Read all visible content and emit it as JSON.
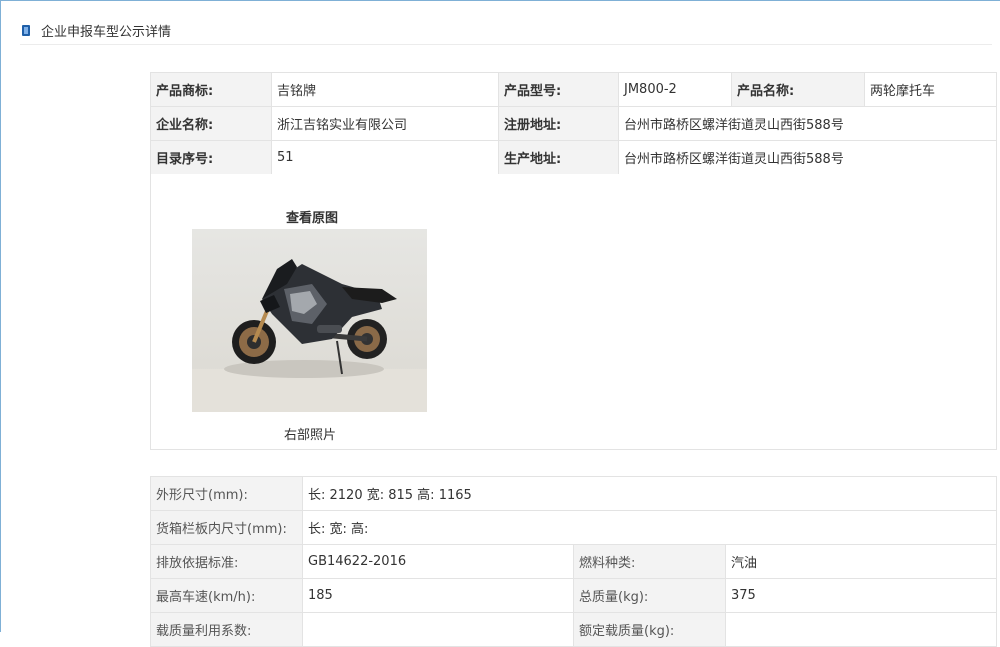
{
  "header": {
    "title": "企业申报车型公示详情",
    "icon": "book-icon"
  },
  "info": {
    "trademark_label": "产品商标:",
    "trademark": "吉铭牌",
    "model_label": "产品型号:",
    "model": "JM800-2",
    "product_name_label": "产品名称:",
    "product_name": "两轮摩托车",
    "company_label": "企业名称:",
    "company": "浙江吉铭实业有限公司",
    "reg_addr_label": "注册地址:",
    "reg_addr": "台州市路桥区螺洋街道灵山西街588号",
    "catalog_label": "目录序号:",
    "catalog": "51",
    "prod_addr_label": "生产地址:",
    "prod_addr": "台州市路桥区螺洋街道灵山西街588号"
  },
  "photo": {
    "view_original": "查看原图",
    "caption": "右部照片"
  },
  "specs": {
    "dimensions_label": "外形尺寸(mm):",
    "dimensions": "长: 2120 宽: 815 高: 1165",
    "cargo_label": "货箱栏板内尺寸(mm):",
    "cargo": "长:  宽:  高:",
    "emission_label": "排放依据标准:",
    "emission": "GB14622-2016",
    "fuel_label": "燃料种类:",
    "fuel": "汽油",
    "speed_label": "最高车速(km/h):",
    "speed": "185",
    "mass_label": "总质量(kg):",
    "mass": "375",
    "util_label": "载质量利用系数:",
    "util": "",
    "rated_label": "额定载质量(kg):",
    "rated": ""
  }
}
